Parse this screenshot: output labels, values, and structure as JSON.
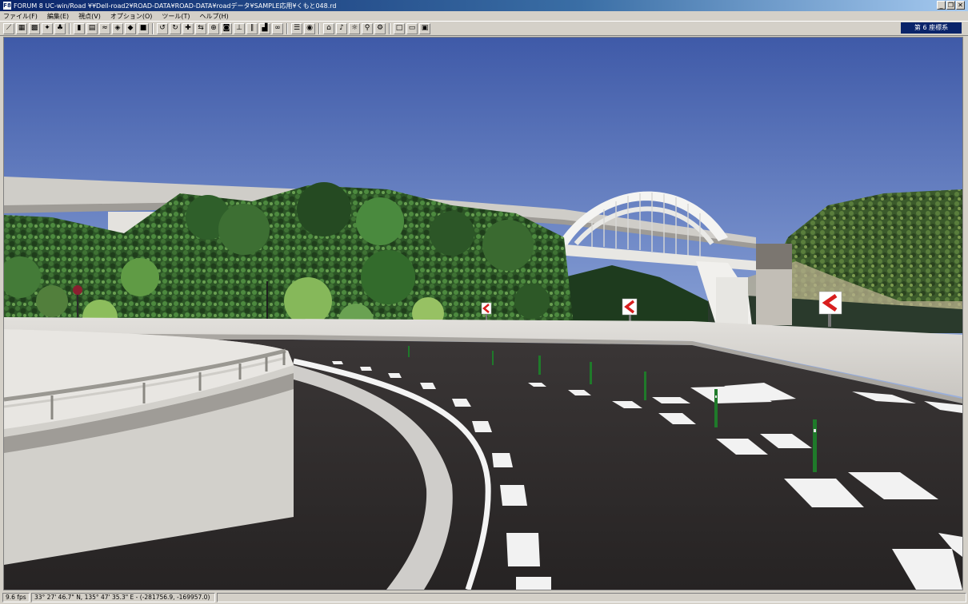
{
  "window": {
    "title": "FORUM 8    UC-win/Road    ¥¥Dell-road2¥ROAD-DATA¥ROAD-DATA¥roadデータ¥SAMPLE応用¥くもと048.rd",
    "app_icon_label": "F8",
    "minimize_label": "_",
    "restore_label": "❐",
    "close_label": "✕"
  },
  "menubar": {
    "items": [
      {
        "label": "ファイル(F)"
      },
      {
        "label": "編集(E)"
      },
      {
        "label": "視点(V)"
      },
      {
        "label": "オプション(O)"
      },
      {
        "label": "ツール(T)"
      },
      {
        "label": "ヘルプ(H)"
      }
    ]
  },
  "toolbar": {
    "display_mode": "第 6 座標系",
    "buttons": [
      {
        "icon": "wand-icon",
        "glyph": "⟋"
      },
      {
        "icon": "terrain-icon",
        "glyph": "▦"
      },
      {
        "icon": "map-icon",
        "glyph": "▩"
      },
      {
        "icon": "person-icon",
        "glyph": "✦"
      },
      {
        "icon": "tree-icon",
        "glyph": "♣"
      },
      {
        "sep": true
      },
      {
        "icon": "book-icon",
        "glyph": "▮"
      },
      {
        "icon": "chart-icon",
        "glyph": "▤"
      },
      {
        "icon": "road-icon",
        "glyph": "≈"
      },
      {
        "icon": "paint-icon",
        "glyph": "◈"
      },
      {
        "icon": "car-icon",
        "glyph": "◆"
      },
      {
        "icon": "truck-icon",
        "glyph": "■"
      },
      {
        "sep": true
      },
      {
        "icon": "rotate-left-icon",
        "glyph": "↺"
      },
      {
        "icon": "rotate-right-icon",
        "glyph": "↻"
      },
      {
        "icon": "move-icon",
        "glyph": "✚"
      },
      {
        "icon": "pan-icon",
        "glyph": "⇆"
      },
      {
        "icon": "zoom-icon",
        "glyph": "⊕"
      },
      {
        "icon": "camera-icon",
        "glyph": "◙"
      },
      {
        "icon": "pin-icon",
        "glyph": "⊥"
      },
      {
        "icon": "pause-icon",
        "glyph": "∥"
      },
      {
        "icon": "drive-icon",
        "glyph": "▟"
      },
      {
        "icon": "bike-icon",
        "glyph": "∞"
      },
      {
        "sep": true
      },
      {
        "icon": "list-icon",
        "glyph": "☰"
      },
      {
        "icon": "record-icon",
        "glyph": "◉"
      },
      {
        "sep": true
      },
      {
        "icon": "camera2-icon",
        "glyph": "⌂"
      },
      {
        "icon": "sound-icon",
        "glyph": "♪"
      },
      {
        "icon": "light-icon",
        "glyph": "☼"
      },
      {
        "icon": "walk-icon",
        "glyph": "⚲"
      },
      {
        "icon": "gear-icon",
        "glyph": "⚙"
      },
      {
        "sep": true
      },
      {
        "icon": "new-icon",
        "glyph": "□"
      },
      {
        "icon": "open-icon",
        "glyph": "▭"
      },
      {
        "icon": "save-icon",
        "glyph": "▣"
      }
    ]
  },
  "status": {
    "fps": "9.6 fps",
    "coords": "33°  27' 46.7\" N, 135°  47' 35.3\" E  -  (-281756.9, -169957.0)"
  },
  "colors": {
    "sky_top": "#3f5aa8",
    "sky_bottom": "#c9d8ea",
    "road": "#2e2b2b",
    "foliage": "#2f5a2a",
    "barrier": "#d8d6d2",
    "chevron_red": "#d81e1e"
  }
}
